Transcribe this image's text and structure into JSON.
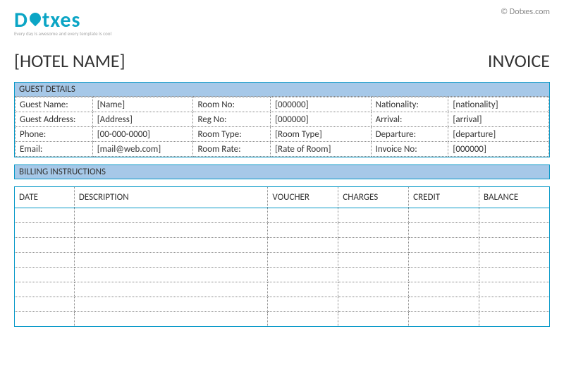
{
  "logo": {
    "text_left": "D",
    "text_right": "txes",
    "tagline": "Every day is awesome and every template is cool"
  },
  "copyright": "© Dotxes.com",
  "header": {
    "hotel_name": "[HOTEL NAME]",
    "invoice_label": "INVOICE"
  },
  "guest_details": {
    "title": "GUEST DETAILS",
    "rows": [
      {
        "l1": "Guest Name:",
        "v1": "[Name]",
        "l2": "Room No:",
        "v2": "[000000]",
        "l3": "Nationality:",
        "v3": "[nationality]"
      },
      {
        "l1": "Guest Address:",
        "v1": "[Address]",
        "l2": "Reg No:",
        "v2": "[000000]",
        "l3": "Arrival:",
        "v3": "[arrival]"
      },
      {
        "l1": "Phone:",
        "v1": "[00-000-0000]",
        "l2": "Room Type:",
        "v2": "[Room Type]",
        "l3": "Departure:",
        "v3": "[departure]"
      },
      {
        "l1": "Email:",
        "v1": "[mail@web.com]",
        "l2": "Room Rate:",
        "v2": "[Rate of Room]",
        "l3": "Invoice No:",
        "v3": "[000000]"
      }
    ]
  },
  "billing": {
    "title": "BILLING INSTRUCTIONS",
    "columns": {
      "date": "DATE",
      "description": "DESCRIPTION",
      "voucher": "VOUCHER",
      "charges": "CHARGES",
      "credit": "CREDIT",
      "balance": "BALANCE"
    },
    "row_count": 8
  }
}
